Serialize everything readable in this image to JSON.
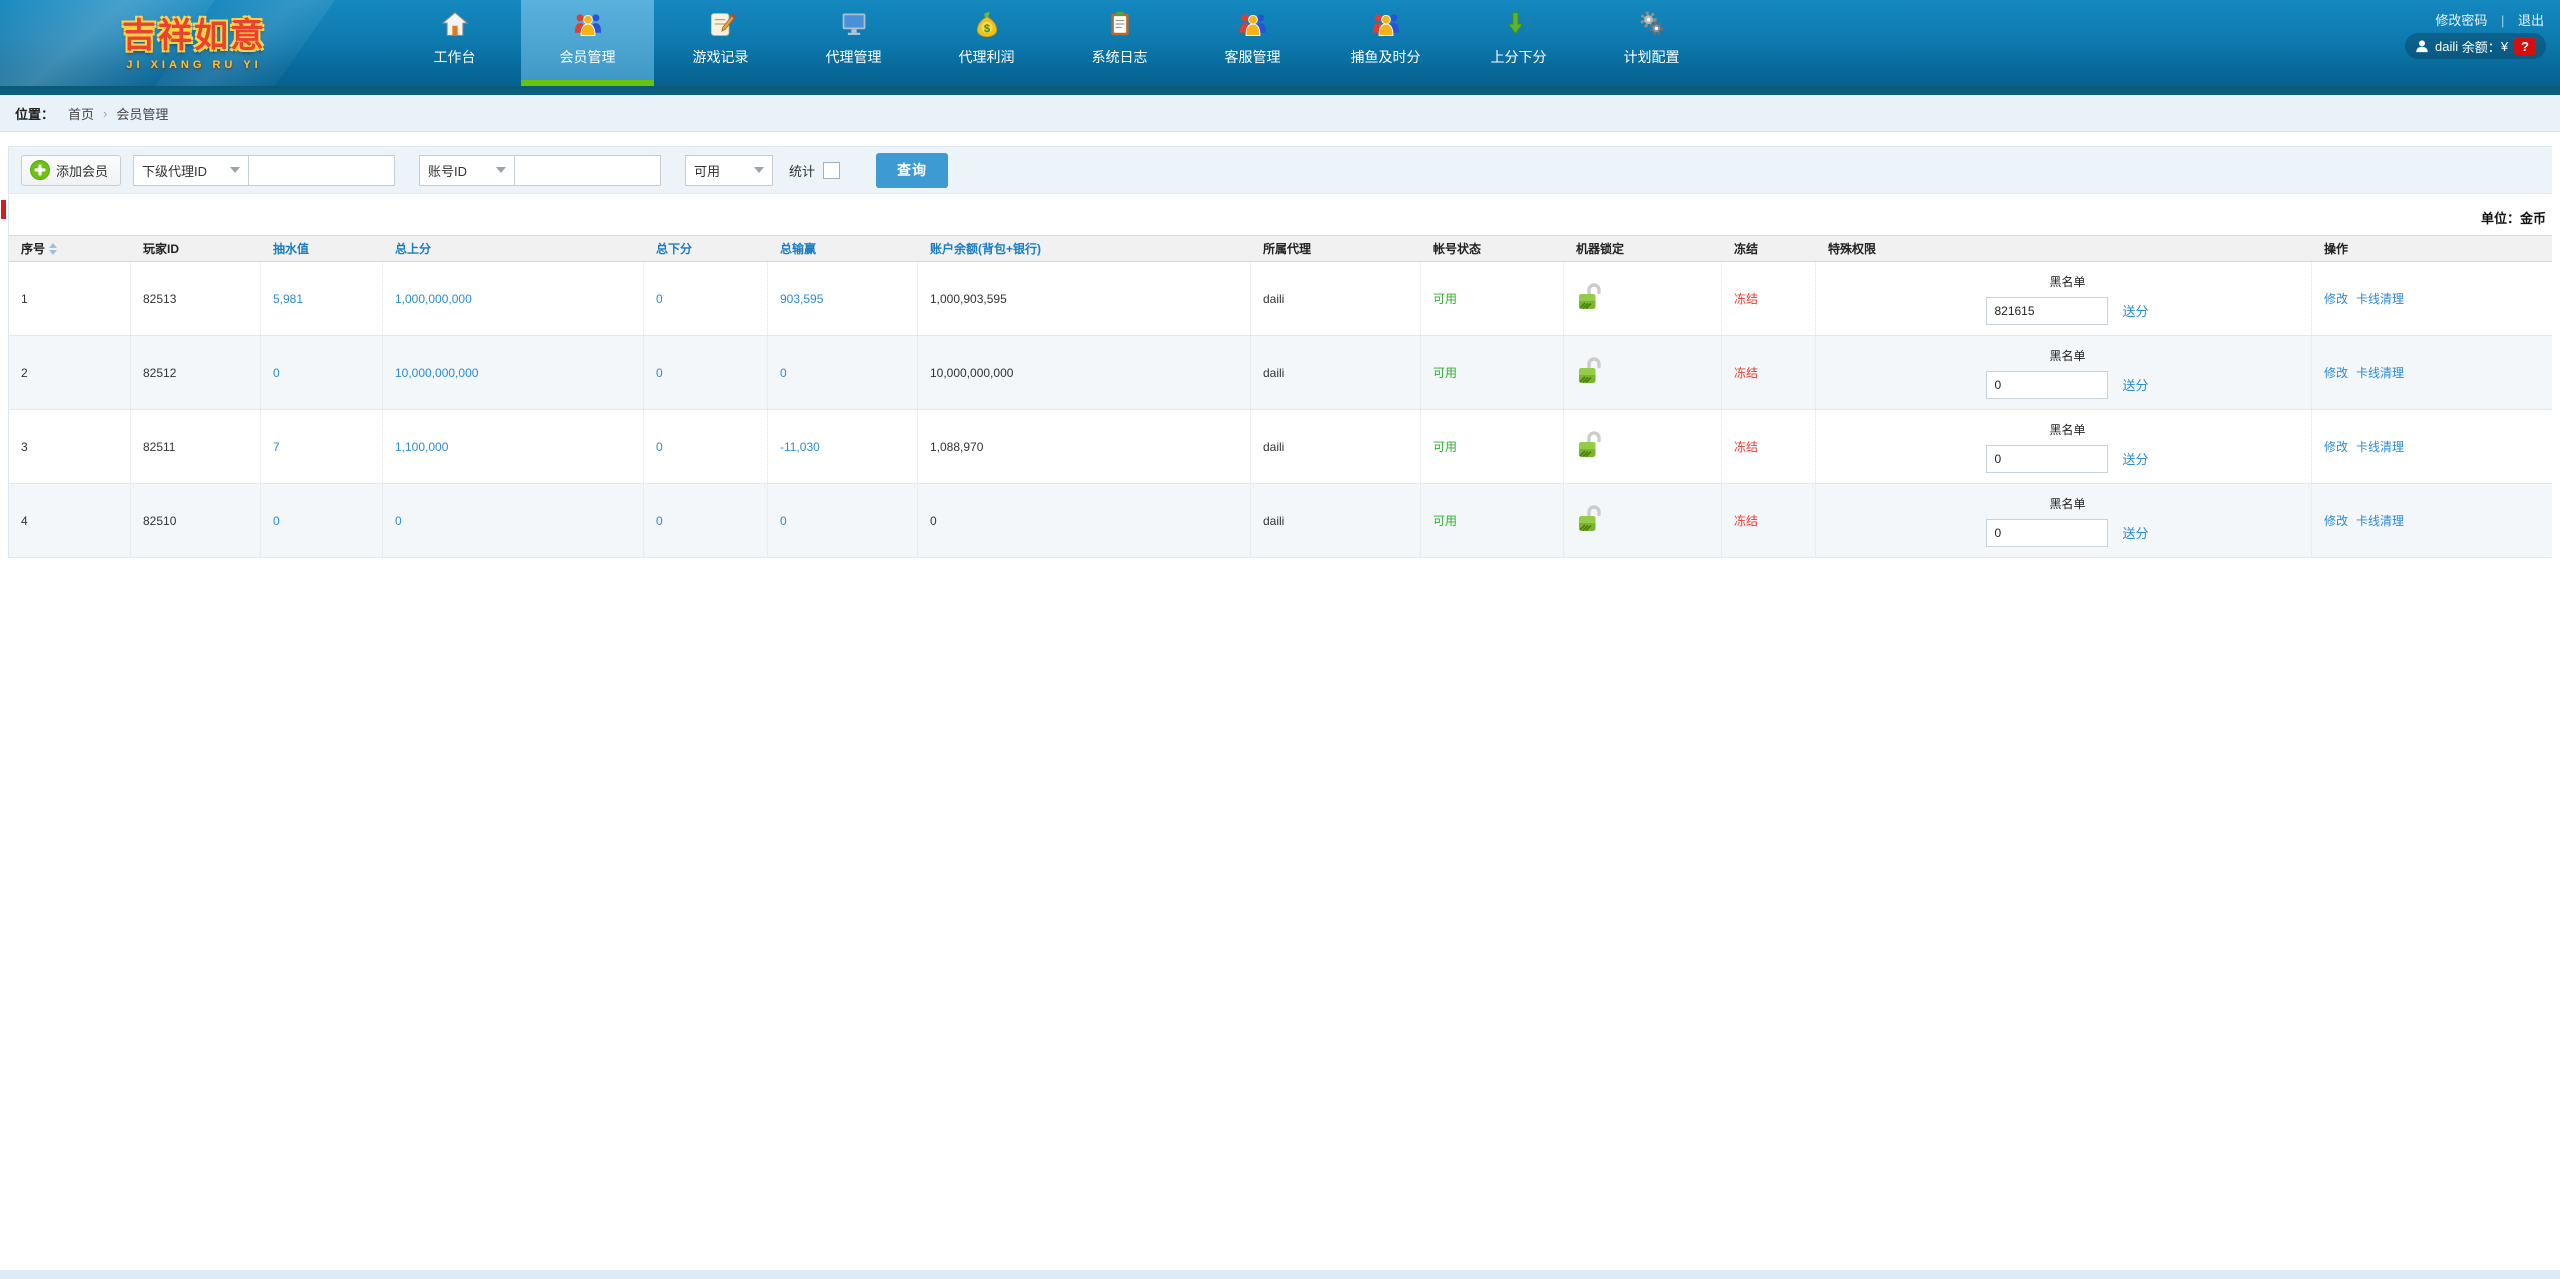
{
  "brand": {
    "title_cn": "吉祥如意",
    "title_en": "JI XIANG RU YI"
  },
  "top_right": {
    "change_password": "修改密码",
    "logout": "退出",
    "divider": "|",
    "user": "daili",
    "balance_label": "余额：",
    "currency": "¥",
    "badge": "?"
  },
  "nav": {
    "items": [
      {
        "label": "工作台",
        "icon": "house-icon",
        "active": false
      },
      {
        "label": "会员管理",
        "icon": "members-icon",
        "active": true
      },
      {
        "label": "游戏记录",
        "icon": "game-records-icon",
        "active": false
      },
      {
        "label": "代理管理",
        "icon": "monitor-icon",
        "active": false
      },
      {
        "label": "代理利润",
        "icon": "moneybag-icon",
        "active": false
      },
      {
        "label": "系统日志",
        "icon": "clipboard-icon",
        "active": false
      },
      {
        "label": "客服管理",
        "icon": "service-icon",
        "active": false
      },
      {
        "label": "捕鱼及时分",
        "icon": "fishing-icon",
        "active": false
      },
      {
        "label": "上分下分",
        "icon": "updown-icon",
        "active": false
      },
      {
        "label": "计划配置",
        "icon": "gears-icon",
        "active": false
      }
    ]
  },
  "breadcrumb": {
    "label": "位置：",
    "home": "首页",
    "separator": "›",
    "current": "会员管理"
  },
  "toolbar": {
    "add_member": "添加会员",
    "select_agent": "下级代理ID",
    "agent_input_value": "",
    "select_account": "账号ID",
    "account_input_value": "",
    "select_status": "可用",
    "stat_label": "统计",
    "search_button": "查询"
  },
  "unit_label": "单位：金币",
  "colors": {
    "accent_blue": "#3e9ad2",
    "link_blue": "#2a8bd6",
    "header_blue": "#1a7dc0",
    "status_green": "#2fae2f",
    "freeze_red": "#ef3b30",
    "nav_active_green": "#66c40e",
    "badge_red": "#d40f0f"
  },
  "table": {
    "headers": [
      "序号",
      "玩家ID",
      "抽水值",
      "总上分",
      "总下分",
      "总输赢",
      "账户余额(背包+银行)",
      "所属代理",
      "帐号状态",
      "机器锁定",
      "冻结",
      "特殊权限",
      "操作"
    ],
    "rows": [
      {
        "seq": "1",
        "player_id": "82513",
        "pump": "5,981",
        "total_up": "1,000,000,000",
        "total_down": "0",
        "total_winloss": "903,595",
        "balance": "1,000,903,595",
        "agent": "daili",
        "status": "可用",
        "lock_icon": "unlocked-icon",
        "freeze_label": "冻结",
        "blacklist_label": "黑名单",
        "blacklist_value": "821615",
        "send_label": "送分",
        "action_edit": "修改",
        "action_clear": "卡线清理"
      },
      {
        "seq": "2",
        "player_id": "82512",
        "pump": "0",
        "total_up": "10,000,000,000",
        "total_down": "0",
        "total_winloss": "0",
        "balance": "10,000,000,000",
        "agent": "daili",
        "status": "可用",
        "lock_icon": "unlocked-icon",
        "freeze_label": "冻结",
        "blacklist_label": "黑名单",
        "blacklist_value": "0",
        "send_label": "送分",
        "action_edit": "修改",
        "action_clear": "卡线清理"
      },
      {
        "seq": "3",
        "player_id": "82511",
        "pump": "7",
        "total_up": "1,100,000",
        "total_down": "0",
        "total_winloss": "-11,030",
        "balance": "1,088,970",
        "agent": "daili",
        "status": "可用",
        "lock_icon": "unlocked-icon",
        "freeze_label": "冻结",
        "blacklist_label": "黑名单",
        "blacklist_value": "0",
        "send_label": "送分",
        "action_edit": "修改",
        "action_clear": "卡线清理"
      },
      {
        "seq": "4",
        "player_id": "82510",
        "pump": "0",
        "total_up": "0",
        "total_down": "0",
        "total_winloss": "0",
        "balance": "0",
        "agent": "daili",
        "status": "可用",
        "lock_icon": "unlocked-icon",
        "freeze_label": "冻结",
        "blacklist_label": "黑名单",
        "blacklist_value": "0",
        "send_label": "送分",
        "action_edit": "修改",
        "action_clear": "卡线清理"
      }
    ]
  }
}
